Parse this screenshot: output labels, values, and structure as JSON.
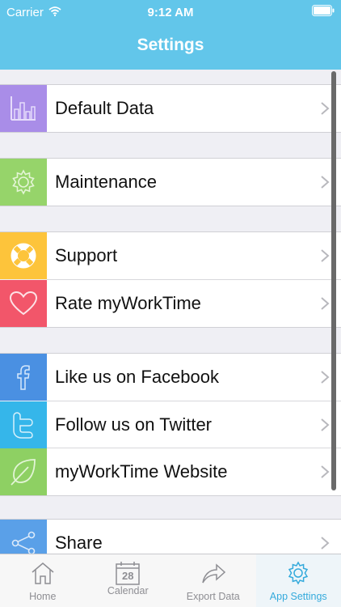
{
  "status": {
    "carrier": "Carrier",
    "time": "9:12 AM"
  },
  "nav": {
    "title": "Settings"
  },
  "rows": [
    {
      "label": "Default Data",
      "icon": "bar-chart-icon",
      "color": "#a98de8"
    },
    {
      "label": "Maintenance",
      "icon": "gear-icon",
      "color": "#96d46a"
    },
    {
      "label": "Support",
      "icon": "lifebuoy-icon",
      "color": "#fdc43b"
    },
    {
      "label": "Rate myWorkTime",
      "icon": "heart-icon",
      "color": "#f2566a"
    },
    {
      "label": "Like us on Facebook",
      "icon": "facebook-icon",
      "color": "#4a90e2"
    },
    {
      "label": "Follow us on Twitter",
      "icon": "twitter-icon",
      "color": "#35b6ea"
    },
    {
      "label": "myWorkTime Website",
      "icon": "leaf-icon",
      "color": "#8ed063"
    },
    {
      "label": "Share",
      "icon": "share-icon",
      "color": "#5aa0e8"
    }
  ],
  "tabs": [
    {
      "label": "Home",
      "icon": "home-icon"
    },
    {
      "label": "Calendar",
      "icon": "calendar-icon",
      "badge": "28"
    },
    {
      "label": "Export Data",
      "icon": "export-icon"
    },
    {
      "label": "App Settings",
      "icon": "gear-icon",
      "active": true
    }
  ],
  "colors": {
    "header": "#62c6ea",
    "accent": "#34aadc",
    "background": "#efeff4"
  }
}
